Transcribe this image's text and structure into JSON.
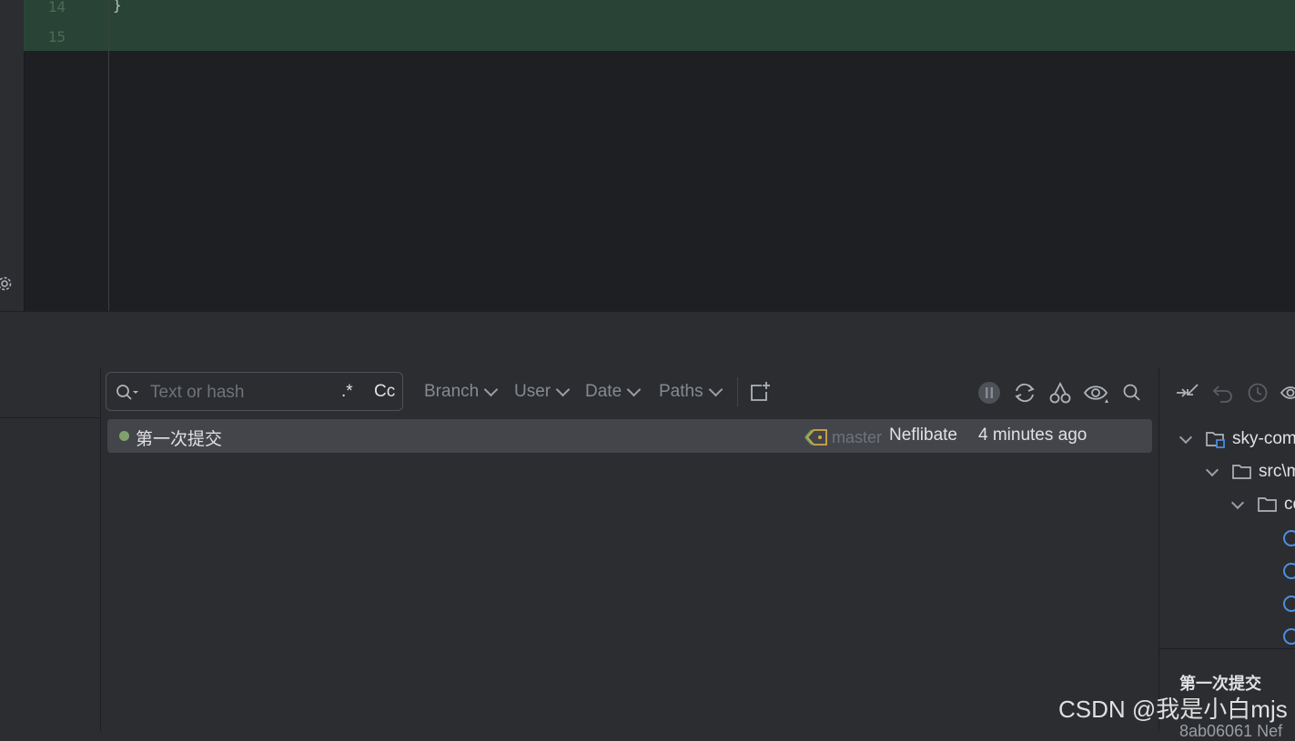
{
  "editor": {
    "lines": [
      {
        "number": "14",
        "code": "}"
      },
      {
        "number": "15",
        "code": ""
      }
    ]
  },
  "log_toolbar": {
    "search_placeholder": "Text or hash",
    "regex_label": ".*",
    "case_label": "Cc",
    "filters": [
      "Branch",
      "User",
      "Date",
      "Paths"
    ]
  },
  "commits": [
    {
      "message": "第一次提交",
      "branch": "master",
      "author": "Neflibate",
      "time": "4 minutes ago"
    }
  ],
  "changes_tree": {
    "root": "sky-com",
    "child": "src\\m",
    "grandchild": "co"
  },
  "commit_details": {
    "subject": "第一次提交",
    "hash_line": "8ab06061 Nef"
  },
  "watermark": "CSDN @我是小白mjs",
  "colors": {
    "editor_bg": "#1e1f22",
    "diff_added_bg": "#294436",
    "panel_bg": "#2b2d30",
    "selected_row_bg": "#43454a",
    "commit_dot": "#7fa26c",
    "class_icon": "#4e8fe0"
  }
}
